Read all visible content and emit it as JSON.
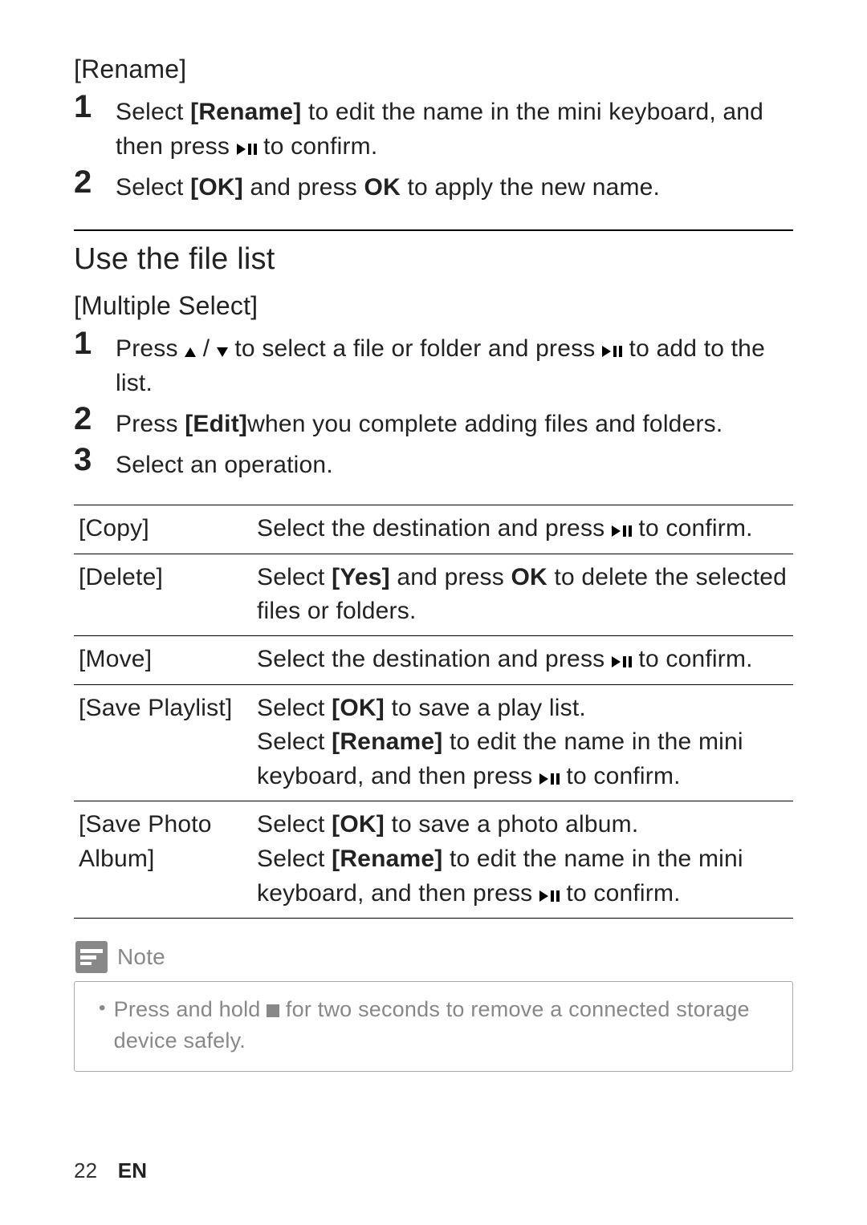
{
  "section1": {
    "title": "[Rename]",
    "steps": [
      {
        "num": "1",
        "pre": "Select ",
        "b1": "[Rename]",
        "mid": " to edit the name in the mini keyboard, and then press ",
        "icon": "play-pause",
        "post": " to confirm."
      },
      {
        "num": "2",
        "pre": "Select ",
        "b1": "[OK]",
        "mid": " and press ",
        "b2": "OK",
        "post": " to apply the new name."
      }
    ]
  },
  "section2": {
    "heading": "Use the file list",
    "subtitle": "[Multiple Select]",
    "steps": [
      {
        "num": "1",
        "pre": "Press ",
        "icon1": "up",
        "sep": " / ",
        "icon2": "down",
        "mid": " to select a file or folder and press ",
        "icon3": "play-pause",
        "post": " to add to the list."
      },
      {
        "num": "2",
        "pre": "Press ",
        "b1": "[Edit]",
        "post": "when you complete adding files and folders."
      },
      {
        "num": "3",
        "post": "Select an operation."
      }
    ]
  },
  "table": [
    {
      "op": "[Copy]",
      "pre": "Select the destination and press ",
      "icon": "play-pause",
      "post": " to confirm."
    },
    {
      "op": "[Delete]",
      "pre": "Select ",
      "b1": "[Yes]",
      "mid": " and press ",
      "b2": "OK",
      "post": " to delete the selected files or folders."
    },
    {
      "op": "[Move]",
      "pre": "Select the destination and press ",
      "icon": "play-pause",
      "post": " to confirm."
    },
    {
      "op": "[Save Playlist]",
      "l1_pre": "Select ",
      "l1_b": "[OK]",
      "l1_post": " to save a play list.",
      "l2_pre": "Select ",
      "l2_b": "[Rename]",
      "l2_mid": " to edit the name in the mini keyboard, and then press ",
      "l2_icon": "play-pause",
      "l2_post": " to confirm."
    },
    {
      "op": "[Save Photo Album]",
      "l1_pre": "Select ",
      "l1_b": "[OK]",
      "l1_post": " to save a photo album.",
      "l2_pre": "Select ",
      "l2_b": "[Rename]",
      "l2_mid": " to edit the name in the mini keyboard, and then press ",
      "l2_icon": "play-pause",
      "l2_post": " to confirm."
    }
  ],
  "note": {
    "label": "Note",
    "pre": "Press and hold ",
    "icon": "stop",
    "post": " for two seconds to remove a connected storage device safely."
  },
  "footer": {
    "page": "22",
    "lang": "EN"
  }
}
